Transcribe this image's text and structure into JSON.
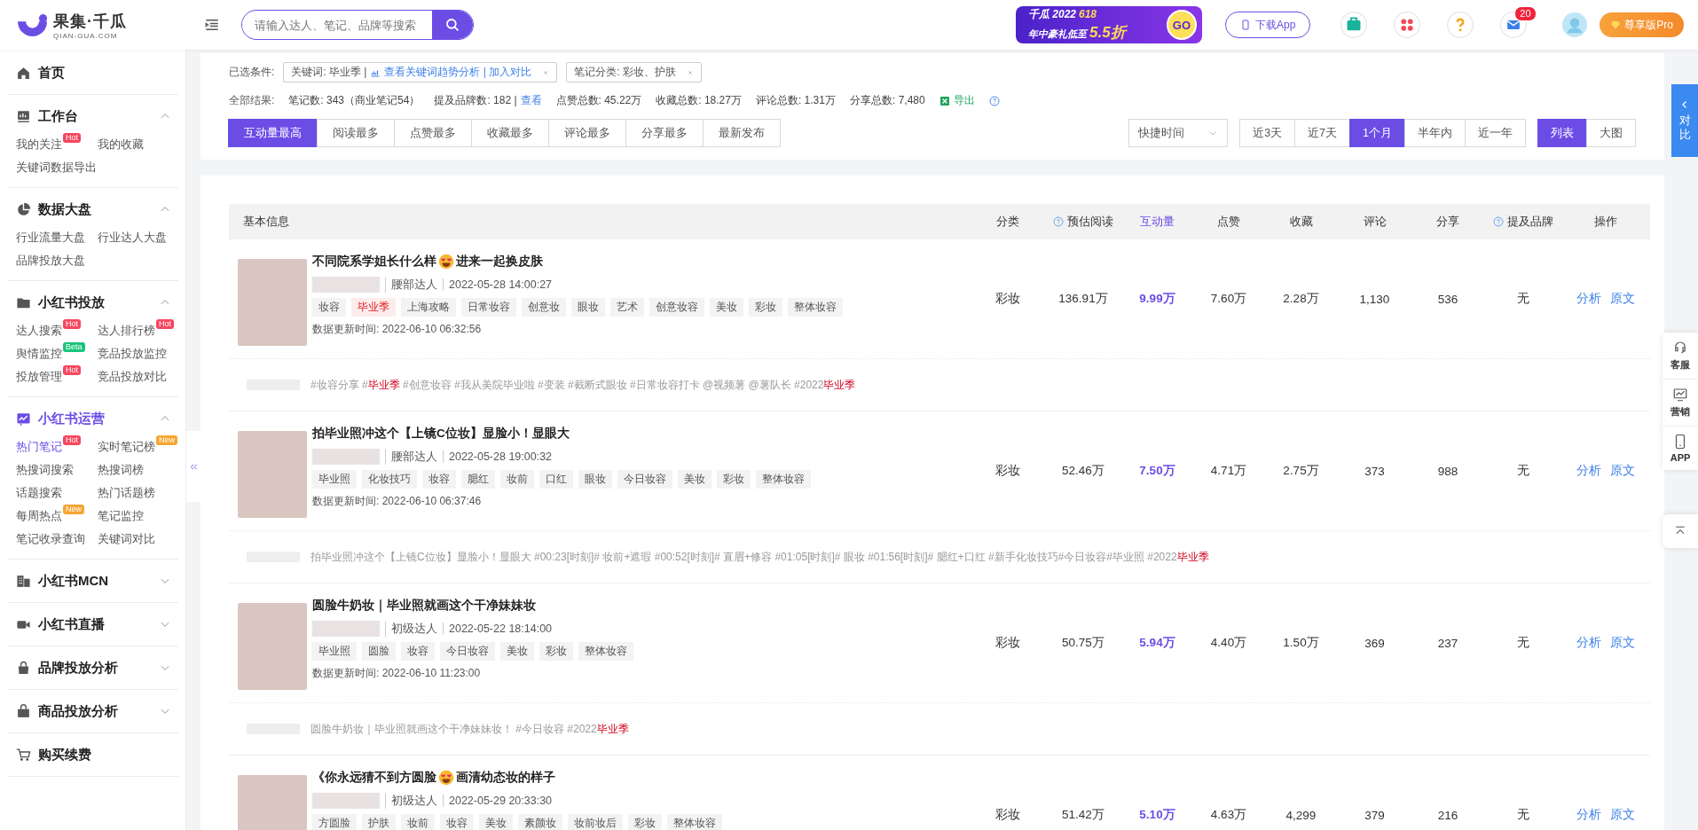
{
  "topbar": {
    "logo": {
      "name": "果集·千瓜",
      "subtitle": "QIAN-GUA.COM"
    },
    "search": {
      "placeholder": "请输入达人、笔记、品牌等搜索"
    },
    "promo": {
      "brand": "千瓜 2022",
      "event": "618",
      "line2": "年中豪礼低至",
      "discount": "5.5折",
      "go": "GO"
    },
    "download": "下载App",
    "mail_count": "20",
    "vip": "尊享版Pro"
  },
  "sidebar": {
    "sections": [
      {
        "title": "首页",
        "selected": false
      },
      {
        "title": "工作台",
        "selected": false,
        "expanded": true,
        "items": [
          {
            "label": "我的关注",
            "selected": false,
            "badge": {
              "text": "Hot",
              "color": "#f5475e"
            }
          },
          {
            "label": "我的收藏",
            "selected": false
          },
          {
            "label": "关键词数据导出",
            "selected": false
          }
        ]
      },
      {
        "title": "数据大盘",
        "selected": false,
        "expanded": true,
        "items": [
          {
            "label": "行业流量大盘",
            "selected": false
          },
          {
            "label": "行业达人大盘",
            "selected": false
          },
          {
            "label": "品牌投放大盘",
            "selected": false
          }
        ]
      },
      {
        "title": "小红书投放",
        "selected": false,
        "expanded": true,
        "items": [
          {
            "label": "达人搜索",
            "selected": false,
            "badge": {
              "text": "Hot",
              "color": "#f5475e"
            }
          },
          {
            "label": "达人排行榜",
            "selected": false,
            "badge": {
              "text": "Hot",
              "color": "#f5475e"
            }
          },
          {
            "label": "舆情监控",
            "selected": false,
            "badge": {
              "text": "Beta",
              "color": "#18c47a"
            }
          },
          {
            "label": "竞品投放监控",
            "selected": false
          },
          {
            "label": "投放管理",
            "selected": false,
            "badge": {
              "text": "Hot",
              "color": "#f5475e"
            }
          },
          {
            "label": "竞品投放对比",
            "selected": false
          }
        ]
      },
      {
        "title": "小红书运营",
        "selected": true,
        "expanded": true,
        "items": [
          {
            "label": "热门笔记",
            "selected": true,
            "badge": {
              "text": "Hot",
              "color": "#f5475e"
            }
          },
          {
            "label": "实时笔记榜",
            "selected": false,
            "badge": {
              "text": "New",
              "color": "#f7a531"
            }
          },
          {
            "label": "热搜词搜索",
            "selected": false
          },
          {
            "label": "热搜词榜",
            "selected": false
          },
          {
            "label": "话题搜索",
            "selected": false
          },
          {
            "label": "热门话题榜",
            "selected": false
          },
          {
            "label": "每周热点",
            "selected": false,
            "badge": {
              "text": "New",
              "color": "#f7a531"
            }
          },
          {
            "label": "笔记监控",
            "selected": false
          },
          {
            "label": "笔记收录查询",
            "selected": false
          },
          {
            "label": "关键词对比",
            "selected": false
          }
        ]
      },
      {
        "title": "小红书MCN",
        "selected": false,
        "expanded": false
      },
      {
        "title": "小红书直播",
        "selected": false,
        "expanded": false
      },
      {
        "title": "品牌投放分析",
        "selected": false,
        "expanded": false
      },
      {
        "title": "商品投放分析",
        "selected": false,
        "expanded": false
      },
      {
        "title": "购买续费",
        "selected": false
      }
    ]
  },
  "filters": {
    "conditions_label": "已选条件:",
    "conditions": [
      {
        "text": "关键词: 毕业季 |",
        "link": "查看关键词趋势分析 | 加入对比"
      },
      {
        "text": "笔记分类: 彩妆、护肤"
      }
    ],
    "summary_label": "全部结果:",
    "summary": [
      {
        "text": "笔记数: 343（商业笔记54）"
      },
      {
        "text": "提及品牌数: 182 |",
        "link": "查看"
      },
      {
        "text": "点赞总数: 45.22万"
      },
      {
        "text": "收藏总数: 18.27万"
      },
      {
        "text": "评论总数: 1.31万"
      },
      {
        "text": "分享总数: 7,480"
      }
    ],
    "export": "导出",
    "sort_tabs": [
      {
        "label": "互动量最高",
        "selected": true
      },
      {
        "label": "阅读最多",
        "selected": false
      },
      {
        "label": "点赞最多",
        "selected": false
      },
      {
        "label": "收藏最多",
        "selected": false
      },
      {
        "label": "评论最多",
        "selected": false
      },
      {
        "label": "分享最多",
        "selected": false
      },
      {
        "label": "最新发布",
        "selected": false
      }
    ],
    "time_dropdown": "快捷时间",
    "ranges": [
      {
        "label": "近3天",
        "selected": false
      },
      {
        "label": "近7天",
        "selected": false
      },
      {
        "label": "1个月",
        "selected": true
      },
      {
        "label": "半年内",
        "selected": false
      },
      {
        "label": "近一年",
        "selected": false
      }
    ],
    "views": [
      {
        "label": "列表",
        "selected": true
      },
      {
        "label": "大图",
        "selected": false
      }
    ]
  },
  "table": {
    "columns": [
      {
        "label": "基本信息",
        "selected": false
      },
      {
        "label": "分类",
        "selected": false
      },
      {
        "label": "预估阅读",
        "selected": false,
        "help": true
      },
      {
        "label": "互动量",
        "selected": true
      },
      {
        "label": "点赞",
        "selected": false
      },
      {
        "label": "收藏",
        "selected": false
      },
      {
        "label": "评论",
        "selected": false
      },
      {
        "label": "分享",
        "selected": false
      },
      {
        "label": "提及品牌",
        "selected": false,
        "help": true
      },
      {
        "label": "操作",
        "selected": false
      }
    ],
    "rows": [
      {
        "title": [
          "不同院系学姐长什么样",
          "进来一起换皮肤"
        ],
        "level": "腰部达人",
        "date": "2022-05-28 14:00:27",
        "tags": [
          {
            "text": "妆容",
            "highlight": false
          },
          {
            "text": "毕业季",
            "highlight": true
          },
          {
            "text": "上海攻略",
            "highlight": false
          },
          {
            "text": "日常妆容",
            "highlight": false
          },
          {
            "text": "创意妆",
            "highlight": false
          },
          {
            "text": "眼妆",
            "highlight": false
          },
          {
            "text": "艺术",
            "highlight": false
          },
          {
            "text": "创意妆容",
            "highlight": false
          },
          {
            "text": "美妆",
            "highlight": false
          },
          {
            "text": "彩妆",
            "highlight": false
          },
          {
            "text": "整体妆容",
            "highlight": false
          }
        ],
        "updated": "数据更新时间:  2022-06-10 06:32:56",
        "values": [
          "彩妆",
          "136.91万",
          "9.99万",
          "7.60万",
          "2.28万",
          "1,130",
          "536",
          "无"
        ],
        "actions": [
          "分析",
          "原文"
        ],
        "description": [
          {
            "text": "#妆容分享 #",
            "highlight": false
          },
          {
            "text": "毕业季",
            "highlight": true
          },
          {
            "text": " #创意妆容 #我从美院毕业啦 #变装 #截断式眼妆 #日常妆容打卡 @视频薯 @薯队长 #2022",
            "highlight": false
          },
          {
            "text": "毕业季",
            "highlight": true
          }
        ]
      },
      {
        "title": [
          "拍毕业照冲这个【上镜C位妆】显脸小！显眼大"
        ],
        "level": "腰部达人",
        "date": "2022-05-28 19:00:32",
        "tags": [
          {
            "text": "毕业照",
            "highlight": false
          },
          {
            "text": "化妆技巧",
            "highlight": false
          },
          {
            "text": "妆容",
            "highlight": false
          },
          {
            "text": "腮红",
            "highlight": false
          },
          {
            "text": "妆前",
            "highlight": false
          },
          {
            "text": "口红",
            "highlight": false
          },
          {
            "text": "眼妆",
            "highlight": false
          },
          {
            "text": "今日妆容",
            "highlight": false
          },
          {
            "text": "美妆",
            "highlight": false
          },
          {
            "text": "彩妆",
            "highlight": false
          },
          {
            "text": "整体妆容",
            "highlight": false
          }
        ],
        "updated": "数据更新时间:  2022-06-10 06:37:46",
        "values": [
          "彩妆",
          "52.46万",
          "7.50万",
          "4.71万",
          "2.75万",
          "373",
          "988",
          "无"
        ],
        "actions": [
          "分析",
          "原文"
        ],
        "description": [
          {
            "text": "拍毕业照冲这个【上镜C位妆】显脸小！显眼大 #00:23[时刻]# 妆前+遮瑕 #00:52[时刻]# 直眉+修容 #01:05[时刻]# 眼妆 #01:56[时刻]# 腮红+口红 #新手化妆技巧#今日妆容#毕业照 #2022",
            "highlight": false
          },
          {
            "text": "毕业季",
            "highlight": true
          }
        ]
      },
      {
        "title": [
          "圆脸牛奶妆｜毕业照就画这个干净妹妹妆"
        ],
        "level": "初级达人",
        "date": "2022-05-22 18:14:00",
        "tags": [
          {
            "text": "毕业照",
            "highlight": false
          },
          {
            "text": "圆脸",
            "highlight": false
          },
          {
            "text": "妆容",
            "highlight": false
          },
          {
            "text": "今日妆容",
            "highlight": false
          },
          {
            "text": "美妆",
            "highlight": false
          },
          {
            "text": "彩妆",
            "highlight": false
          },
          {
            "text": "整体妆容",
            "highlight": false
          }
        ],
        "updated": "数据更新时间:  2022-06-10 11:23:00",
        "values": [
          "彩妆",
          "50.75万",
          "5.94万",
          "4.40万",
          "1.50万",
          "369",
          "237",
          "无"
        ],
        "actions": [
          "分析",
          "原文"
        ],
        "description": [
          {
            "text": "圆脸牛奶妆｜毕业照就画这个干净妹妹妆！ #今日妆容 #2022",
            "highlight": false
          },
          {
            "text": "毕业季",
            "highlight": true
          }
        ]
      },
      {
        "title": [
          "《你永远猜不到方圆脸",
          "画清幼态妆的样子"
        ],
        "level": "初级达人",
        "date": "2022-05-29 20:33:30",
        "tags": [
          {
            "text": "方圆脸",
            "highlight": false
          },
          {
            "text": "护肤",
            "highlight": false
          },
          {
            "text": "妆前",
            "highlight": false
          },
          {
            "text": "妆容",
            "highlight": false
          },
          {
            "text": "美妆",
            "highlight": false
          },
          {
            "text": "素颜妆",
            "highlight": false
          },
          {
            "text": "妆前妆后",
            "highlight": false
          },
          {
            "text": "彩妆",
            "highlight": false
          },
          {
            "text": "整体妆容",
            "highlight": false
          }
        ],
        "values": [
          "彩妆",
          "51.42万",
          "5.10万",
          "4.63万",
          "4,299",
          "379",
          "216",
          "无"
        ],
        "actions": [
          "分析",
          "原文"
        ]
      }
    ]
  },
  "float": {
    "compare": "对比",
    "tools": [
      "客服",
      "营销",
      "APP"
    ]
  }
}
